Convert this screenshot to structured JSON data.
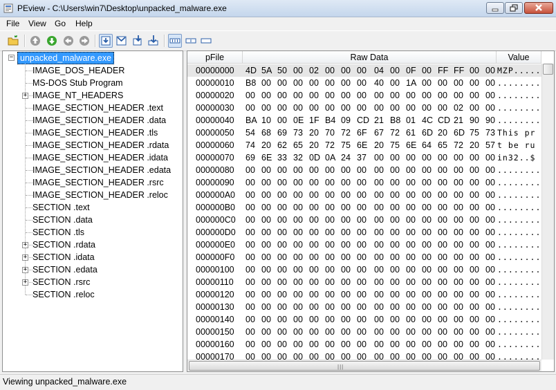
{
  "window": {
    "title": "PEview - C:\\Users\\win7\\Desktop\\unpacked_malware.exe",
    "accent": "#3399ff"
  },
  "menu": [
    "File",
    "View",
    "Go",
    "Help"
  ],
  "toolbar": {
    "icons": [
      "open-file-icon",
      "go-up-icon",
      "go-down-icon",
      "back-icon",
      "forward-icon",
      "view-byte-icon",
      "view-mark-icon",
      "view-save-icon",
      "view-down-icon",
      "hex-view-icon",
      "word-view-icon",
      "dword-view-icon"
    ]
  },
  "tree": {
    "root": "unpacked_malware.exe",
    "items": [
      {
        "label": "IMAGE_DOS_HEADER",
        "expandable": false
      },
      {
        "label": "MS-DOS Stub Program",
        "expandable": false
      },
      {
        "label": "IMAGE_NT_HEADERS",
        "expandable": true
      },
      {
        "label": "IMAGE_SECTION_HEADER .text",
        "expandable": false
      },
      {
        "label": "IMAGE_SECTION_HEADER .data",
        "expandable": false
      },
      {
        "label": "IMAGE_SECTION_HEADER .tls",
        "expandable": false
      },
      {
        "label": "IMAGE_SECTION_HEADER .rdata",
        "expandable": false
      },
      {
        "label": "IMAGE_SECTION_HEADER .idata",
        "expandable": false
      },
      {
        "label": "IMAGE_SECTION_HEADER .edata",
        "expandable": false
      },
      {
        "label": "IMAGE_SECTION_HEADER .rsrc",
        "expandable": false
      },
      {
        "label": "IMAGE_SECTION_HEADER .reloc",
        "expandable": false
      },
      {
        "label": "SECTION .text",
        "expandable": false
      },
      {
        "label": "SECTION .data",
        "expandable": false
      },
      {
        "label": "SECTION .tls",
        "expandable": false
      },
      {
        "label": "SECTION .rdata",
        "expandable": true
      },
      {
        "label": "SECTION .idata",
        "expandable": true
      },
      {
        "label": "SECTION .edata",
        "expandable": true
      },
      {
        "label": "SECTION .rsrc",
        "expandable": true
      },
      {
        "label": "SECTION .reloc",
        "expandable": false
      }
    ]
  },
  "hex": {
    "headers": {
      "pfile": "pFile",
      "raw": "Raw Data",
      "value": "Value"
    },
    "rows": [
      {
        "offset": "00000000",
        "bytes": [
          "4D",
          "5A",
          "50",
          "00",
          "02",
          "00",
          "00",
          "00",
          "04",
          "00",
          "0F",
          "00",
          "FF",
          "FF",
          "00",
          "00"
        ],
        "value": "MZP....."
      },
      {
        "offset": "00000010",
        "bytes": [
          "B8",
          "00",
          "00",
          "00",
          "00",
          "00",
          "00",
          "00",
          "40",
          "00",
          "1A",
          "00",
          "00",
          "00",
          "00",
          "00"
        ],
        "value": "........"
      },
      {
        "offset": "00000020",
        "bytes": [
          "00",
          "00",
          "00",
          "00",
          "00",
          "00",
          "00",
          "00",
          "00",
          "00",
          "00",
          "00",
          "00",
          "00",
          "00",
          "00"
        ],
        "value": "........"
      },
      {
        "offset": "00000030",
        "bytes": [
          "00",
          "00",
          "00",
          "00",
          "00",
          "00",
          "00",
          "00",
          "00",
          "00",
          "00",
          "00",
          "00",
          "02",
          "00",
          "00"
        ],
        "value": "........"
      },
      {
        "offset": "00000040",
        "bytes": [
          "BA",
          "10",
          "00",
          "0E",
          "1F",
          "B4",
          "09",
          "CD",
          "21",
          "B8",
          "01",
          "4C",
          "CD",
          "21",
          "90",
          "90"
        ],
        "value": "........"
      },
      {
        "offset": "00000050",
        "bytes": [
          "54",
          "68",
          "69",
          "73",
          "20",
          "70",
          "72",
          "6F",
          "67",
          "72",
          "61",
          "6D",
          "20",
          "6D",
          "75",
          "73"
        ],
        "value": "This pr"
      },
      {
        "offset": "00000060",
        "bytes": [
          "74",
          "20",
          "62",
          "65",
          "20",
          "72",
          "75",
          "6E",
          "20",
          "75",
          "6E",
          "64",
          "65",
          "72",
          "20",
          "57"
        ],
        "value": "t be ru"
      },
      {
        "offset": "00000070",
        "bytes": [
          "69",
          "6E",
          "33",
          "32",
          "0D",
          "0A",
          "24",
          "37",
          "00",
          "00",
          "00",
          "00",
          "00",
          "00",
          "00",
          "00"
        ],
        "value": "in32..$"
      },
      {
        "offset": "00000080",
        "bytes": [
          "00",
          "00",
          "00",
          "00",
          "00",
          "00",
          "00",
          "00",
          "00",
          "00",
          "00",
          "00",
          "00",
          "00",
          "00",
          "00"
        ],
        "value": "........"
      },
      {
        "offset": "00000090",
        "bytes": [
          "00",
          "00",
          "00",
          "00",
          "00",
          "00",
          "00",
          "00",
          "00",
          "00",
          "00",
          "00",
          "00",
          "00",
          "00",
          "00"
        ],
        "value": "........"
      },
      {
        "offset": "000000A0",
        "bytes": [
          "00",
          "00",
          "00",
          "00",
          "00",
          "00",
          "00",
          "00",
          "00",
          "00",
          "00",
          "00",
          "00",
          "00",
          "00",
          "00"
        ],
        "value": "........"
      },
      {
        "offset": "000000B0",
        "bytes": [
          "00",
          "00",
          "00",
          "00",
          "00",
          "00",
          "00",
          "00",
          "00",
          "00",
          "00",
          "00",
          "00",
          "00",
          "00",
          "00"
        ],
        "value": "........"
      },
      {
        "offset": "000000C0",
        "bytes": [
          "00",
          "00",
          "00",
          "00",
          "00",
          "00",
          "00",
          "00",
          "00",
          "00",
          "00",
          "00",
          "00",
          "00",
          "00",
          "00"
        ],
        "value": "........"
      },
      {
        "offset": "000000D0",
        "bytes": [
          "00",
          "00",
          "00",
          "00",
          "00",
          "00",
          "00",
          "00",
          "00",
          "00",
          "00",
          "00",
          "00",
          "00",
          "00",
          "00"
        ],
        "value": "........"
      },
      {
        "offset": "000000E0",
        "bytes": [
          "00",
          "00",
          "00",
          "00",
          "00",
          "00",
          "00",
          "00",
          "00",
          "00",
          "00",
          "00",
          "00",
          "00",
          "00",
          "00"
        ],
        "value": "........"
      },
      {
        "offset": "000000F0",
        "bytes": [
          "00",
          "00",
          "00",
          "00",
          "00",
          "00",
          "00",
          "00",
          "00",
          "00",
          "00",
          "00",
          "00",
          "00",
          "00",
          "00"
        ],
        "value": "........"
      },
      {
        "offset": "00000100",
        "bytes": [
          "00",
          "00",
          "00",
          "00",
          "00",
          "00",
          "00",
          "00",
          "00",
          "00",
          "00",
          "00",
          "00",
          "00",
          "00",
          "00"
        ],
        "value": "........"
      },
      {
        "offset": "00000110",
        "bytes": [
          "00",
          "00",
          "00",
          "00",
          "00",
          "00",
          "00",
          "00",
          "00",
          "00",
          "00",
          "00",
          "00",
          "00",
          "00",
          "00"
        ],
        "value": "........"
      },
      {
        "offset": "00000120",
        "bytes": [
          "00",
          "00",
          "00",
          "00",
          "00",
          "00",
          "00",
          "00",
          "00",
          "00",
          "00",
          "00",
          "00",
          "00",
          "00",
          "00"
        ],
        "value": "........"
      },
      {
        "offset": "00000130",
        "bytes": [
          "00",
          "00",
          "00",
          "00",
          "00",
          "00",
          "00",
          "00",
          "00",
          "00",
          "00",
          "00",
          "00",
          "00",
          "00",
          "00"
        ],
        "value": "........"
      },
      {
        "offset": "00000140",
        "bytes": [
          "00",
          "00",
          "00",
          "00",
          "00",
          "00",
          "00",
          "00",
          "00",
          "00",
          "00",
          "00",
          "00",
          "00",
          "00",
          "00"
        ],
        "value": "........"
      },
      {
        "offset": "00000150",
        "bytes": [
          "00",
          "00",
          "00",
          "00",
          "00",
          "00",
          "00",
          "00",
          "00",
          "00",
          "00",
          "00",
          "00",
          "00",
          "00",
          "00"
        ],
        "value": "........"
      },
      {
        "offset": "00000160",
        "bytes": [
          "00",
          "00",
          "00",
          "00",
          "00",
          "00",
          "00",
          "00",
          "00",
          "00",
          "00",
          "00",
          "00",
          "00",
          "00",
          "00"
        ],
        "value": "........"
      },
      {
        "offset": "00000170",
        "bytes": [
          "00",
          "00",
          "00",
          "00",
          "00",
          "00",
          "00",
          "00",
          "00",
          "00",
          "00",
          "00",
          "00",
          "00",
          "00",
          "00"
        ],
        "value": "........"
      }
    ]
  },
  "status": {
    "text": "Viewing unpacked_malware.exe"
  }
}
